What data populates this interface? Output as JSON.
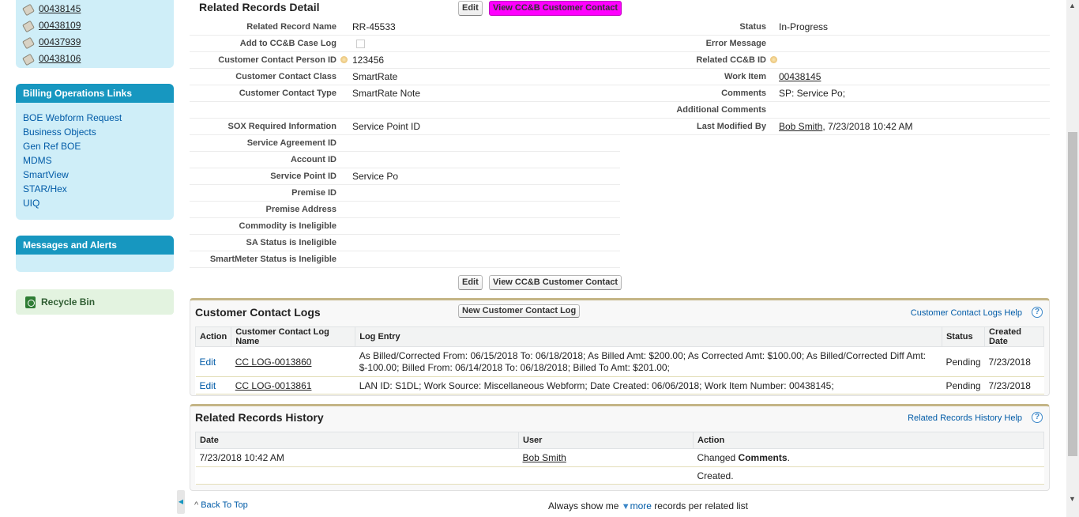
{
  "sidebar": {
    "recent": [
      "00438145",
      "00438109",
      "00437939",
      "00438106"
    ],
    "billing": {
      "title": "Billing Operations Links",
      "links": [
        "BOE Webform Request",
        "Business Objects",
        "Gen Ref BOE",
        "MDMS",
        "SmartView",
        "STAR/Hex",
        "UIQ"
      ]
    },
    "messages": {
      "title": "Messages and Alerts"
    },
    "recycle": "Recycle Bin"
  },
  "detail": {
    "title": "Related Records Detail",
    "edit": "Edit",
    "view_contact": "View CC&B Customer Contact",
    "left": [
      {
        "label": "Related Record Name",
        "value": "RR-45533"
      },
      {
        "label": "Add to CC&B Case Log",
        "value": ""
      },
      {
        "label": "Customer Contact Person ID",
        "value": "123456"
      },
      {
        "label": "Customer Contact Class",
        "value": "SmartRate"
      },
      {
        "label": "Customer Contact Type",
        "value": "SmartRate Note"
      },
      {
        "label": "",
        "value": ""
      },
      {
        "label": "SOX Required Information",
        "value": "Service Point ID"
      },
      {
        "label": "Service Agreement ID",
        "value": ""
      },
      {
        "label": "Account ID",
        "value": ""
      },
      {
        "label": "Service Point ID",
        "value": "Service Po"
      },
      {
        "label": "Premise ID",
        "value": ""
      },
      {
        "label": "Premise Address",
        "value": ""
      },
      {
        "label": "Commodity is Ineligible",
        "value": ""
      },
      {
        "label": "SA Status is Ineligible",
        "value": ""
      },
      {
        "label": "SmartMeter Status is Ineligible",
        "value": ""
      }
    ],
    "right": [
      {
        "label": "Status",
        "value": "In-Progress"
      },
      {
        "label": "Error Message",
        "value": ""
      },
      {
        "label": "Related CC&B ID",
        "value": ""
      },
      {
        "label": "Work Item",
        "value": "00438145"
      },
      {
        "label": "Comments",
        "value": "SP: Service Po;"
      },
      {
        "label": "Additional Comments",
        "value": ""
      },
      {
        "label": "Last Modified By",
        "value": "Bob Smith",
        "extra": ", 7/23/2018 10:42 AM"
      }
    ]
  },
  "logs": {
    "title": "Customer Contact Logs",
    "new_btn": "New Customer Contact Log",
    "help": "Customer Contact Logs Help",
    "qmark": "?",
    "headers": [
      "Action",
      "Customer Contact Log Name",
      "Log Entry",
      "Status",
      "Created Date"
    ],
    "rows": [
      {
        "action": "Edit",
        "name": "CC LOG-0013860",
        "entry": "As Billed/Corrected From: 06/15/2018 To: 06/18/2018; As Billed Amt: $200.00; As Corrected Amt: $100.00; As Billed/Corrected Diff Amt: $-100.00; Billed From: 06/14/2018 To: 06/18/2018; Billed To Amt: $201.00;",
        "status": "Pending",
        "date": "7/23/2018"
      },
      {
        "action": "Edit",
        "name": "CC LOG-0013861",
        "entry": "LAN ID: S1DL; Work Source: Miscellaneous Webform; Date Created: 06/06/2018; Work Item Number: 00438145;",
        "status": "Pending",
        "date": "7/23/2018"
      }
    ]
  },
  "history": {
    "title": "Related Records History",
    "help": "Related Records History Help",
    "qmark": "?",
    "headers": [
      "Date",
      "User",
      "Action"
    ],
    "rows": [
      {
        "date": "7/23/2018 10:42 AM",
        "user": "Bob Smith",
        "action_pre": "Changed ",
        "action_bold": "Comments",
        "action_post": "."
      },
      {
        "date": "",
        "user": "",
        "action_pre": "Created.",
        "action_bold": "",
        "action_post": ""
      }
    ]
  },
  "footer": {
    "back": "Back To Top",
    "always": "Always show me",
    "more": "more",
    "records": "records per related list"
  }
}
